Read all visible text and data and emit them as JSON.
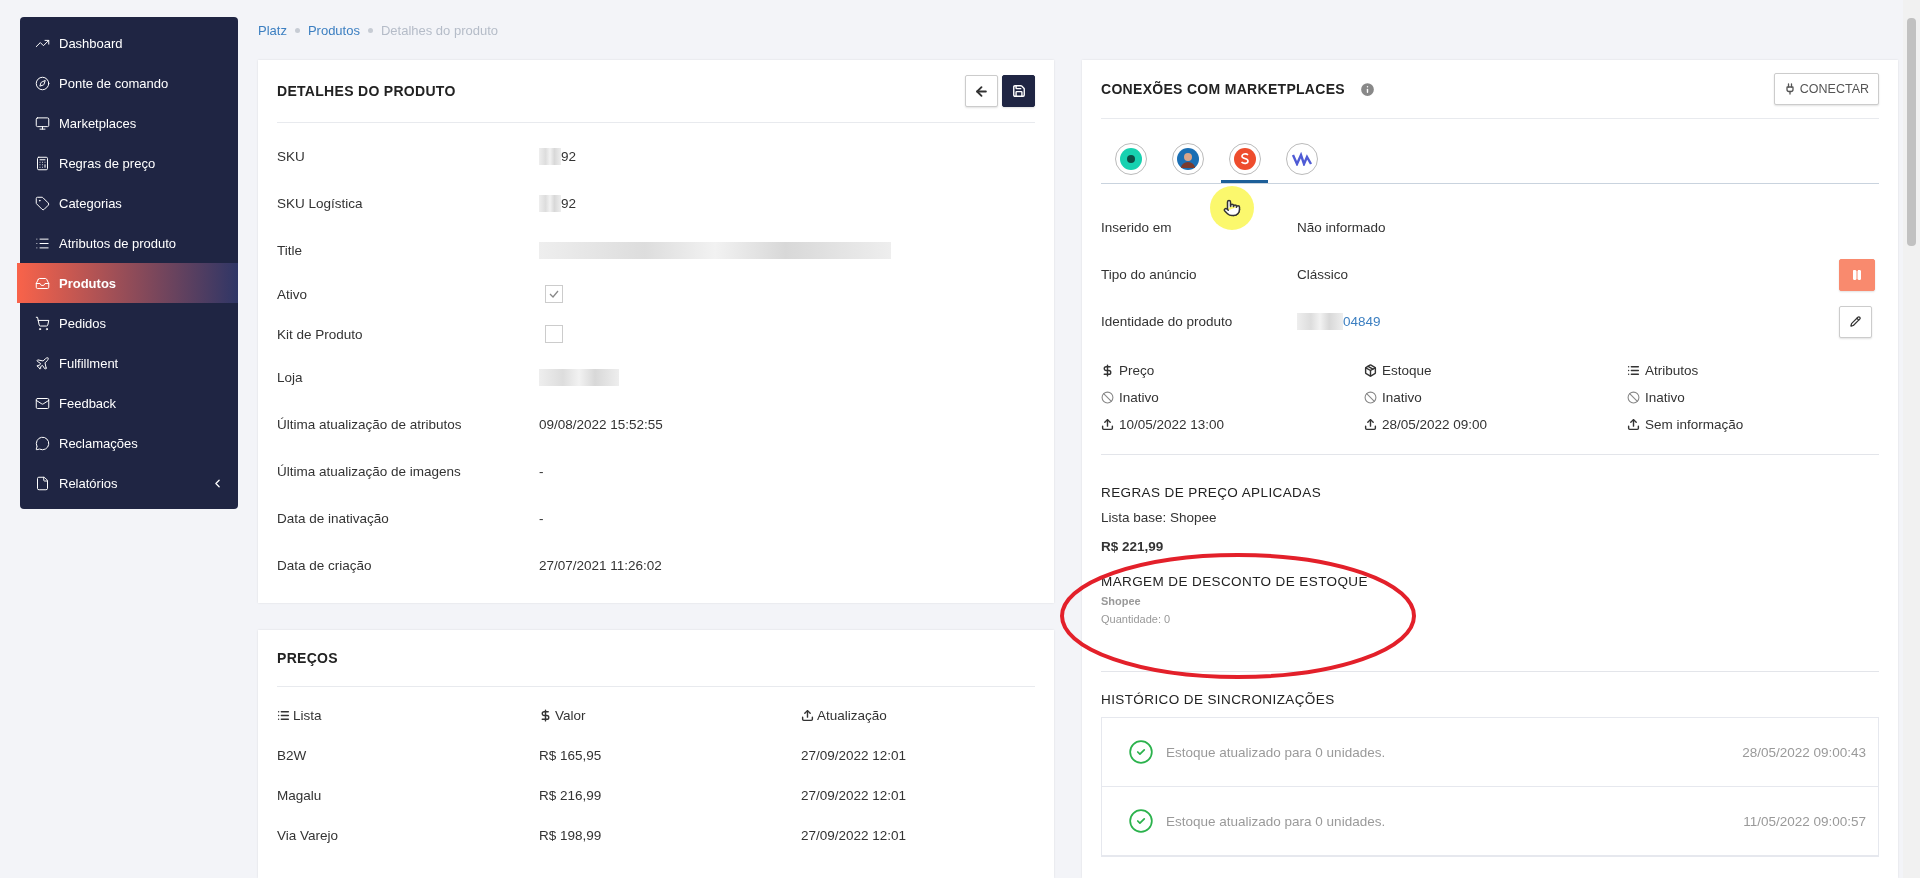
{
  "sidebar": {
    "items": [
      {
        "label": "Dashboard",
        "selected": false
      },
      {
        "label": "Ponte de comando",
        "selected": false
      },
      {
        "label": "Marketplaces",
        "selected": false
      },
      {
        "label": "Regras de preço",
        "selected": false
      },
      {
        "label": "Categorias",
        "selected": false
      },
      {
        "label": "Atributos de produto",
        "selected": false
      },
      {
        "label": "Produtos",
        "selected": true
      },
      {
        "label": "Pedidos",
        "selected": false
      },
      {
        "label": "Fulfillment",
        "selected": false
      },
      {
        "label": "Feedback",
        "selected": false
      },
      {
        "label": "Reclamações",
        "selected": false
      },
      {
        "label": "Relatórios",
        "selected": false,
        "expanded": false
      }
    ]
  },
  "breadcrumb": [
    {
      "label": "Platz",
      "current": false
    },
    {
      "label": "Produtos",
      "current": false
    },
    {
      "label": "Detalhes do produto",
      "current": true
    }
  ],
  "product": {
    "title": "DETALHES DO PRODUTO",
    "fields": [
      {
        "label": "SKU",
        "kind": "redacted",
        "value": "92"
      },
      {
        "label": "SKU Logística",
        "kind": "redacted",
        "value": "92"
      },
      {
        "label": "Title",
        "kind": "blurred"
      },
      {
        "label": "Ativo",
        "kind": "checkbox",
        "checked": true
      },
      {
        "label": "Kit de Produto",
        "kind": "checkbox",
        "checked": false
      },
      {
        "label": "Loja",
        "kind": "blurred"
      },
      {
        "label": "Última atualização de atributos",
        "kind": "text",
        "value": "09/08/2022 15:52:55"
      },
      {
        "label": "Última atualização de imagens",
        "kind": "text",
        "value": "-"
      },
      {
        "label": "Data de inativação",
        "kind": "text",
        "value": "-"
      },
      {
        "label": "Data de criação",
        "kind": "text",
        "value": "27/07/2021 11:26:02"
      }
    ]
  },
  "prices": {
    "title": "PREÇOS",
    "columns": [
      "Lista",
      "Valor",
      "Atualização"
    ],
    "rows": [
      [
        "B2W",
        "R$ 165,95",
        "27/09/2022 12:01"
      ],
      [
        "Magalu",
        "R$ 216,99",
        "27/09/2022 12:01"
      ],
      [
        "Via Varejo",
        "R$ 198,99",
        "27/09/2022 12:01"
      ]
    ]
  },
  "connections": {
    "title": "CONEXÕES COM MARKETPLACES",
    "connect_button": "CONECTAR",
    "tabs": [
      {
        "selected": false
      },
      {
        "selected": false
      },
      {
        "selected": true
      },
      {
        "selected": false
      }
    ],
    "fields": [
      {
        "label": "Inserido em",
        "value": "Não informado",
        "kind": "text"
      },
      {
        "label": "Tipo do anúncio",
        "value": "Clássico",
        "kind": "pausable"
      },
      {
        "label": "Identidade do produto",
        "value": "04849",
        "kind": "editable-link"
      }
    ],
    "status": [
      {
        "label": "Preço",
        "state": "Inativo",
        "date": "10/05/2022 13:00"
      },
      {
        "label": "Estoque",
        "state": "Inativo",
        "date": "28/05/2022 09:00"
      },
      {
        "label": "Atributos",
        "state": "Inativo",
        "date": "Sem informação"
      }
    ],
    "rules_title": "REGRAS DE PREÇO APLICADAS",
    "base_list": "Lista base: Shopee",
    "price": "R$ 221,99",
    "margin_title": "MARGEM DE DESCONTO DE ESTOQUE",
    "margin_store": "Shopee",
    "margin_qty": "Quantidade: 0",
    "history_title": "HISTÓRICO DE SINCRONIZAÇÕES",
    "history": [
      {
        "text": "Estoque atualizado para 0 unidades.",
        "date": "28/05/2022 09:00:43"
      },
      {
        "text": "Estoque atualizado para 0 unidades.",
        "date": "11/05/2022 09:00:57"
      }
    ]
  }
}
